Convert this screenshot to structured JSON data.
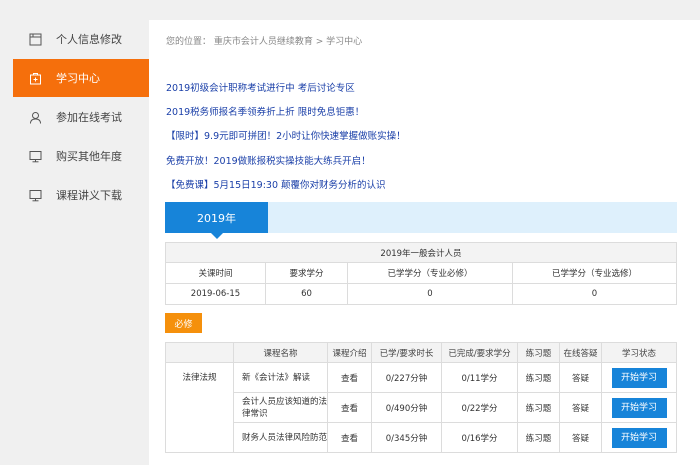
{
  "sidebar": {
    "items": [
      {
        "label": "个人信息修改",
        "icon": "profile-edit-icon"
      },
      {
        "label": "学习中心",
        "icon": "study-center-icon"
      },
      {
        "label": "参加在线考试",
        "icon": "user-icon"
      },
      {
        "label": "购买其他年度",
        "icon": "monitor-icon"
      },
      {
        "label": "课程讲义下载",
        "icon": "monitor-icon"
      }
    ],
    "active_color": "#f56f0c"
  },
  "breadcrumb": {
    "prefix": "您的位置：",
    "path": "重庆市会计人员继续教育 > 学习中心"
  },
  "notices": [
    "2019初级会计职称考试进行中 考后讨论专区",
    "2019税务师报名季领券折上折 限时免息钜惠！",
    "【限时】9.9元即可拼团！2小时让你快速掌握做账实操！",
    "免费开放！2019做账报税实操技能大练兵开启！",
    "【免费课】5月15日19:30 颠覆你对财务分析的认识"
  ],
  "year_tab": "2019年",
  "summary": {
    "title": "2019年一般会计人员",
    "headers": [
      "关课时间",
      "要求学分",
      "已学学分（专业必修）",
      "已学学分（专业选修）"
    ],
    "values": [
      "2019-06-15",
      "60",
      "0",
      "0"
    ]
  },
  "required_badge": "必修",
  "course_table": {
    "headers": [
      "课程名称",
      "课程介绍",
      "已学/要求时长",
      "已完成/要求学分",
      "练习题",
      "在线答疑",
      "学习状态"
    ],
    "category": "法律法规",
    "rows": [
      {
        "name": "新《会计法》解读",
        "intro": "查看",
        "time": "0/227分钟",
        "credit": "0/11学分",
        "exercise": "练习题",
        "qa": "答疑",
        "status": "开始学习"
      },
      {
        "name": "会计人员应该知道的法律常识",
        "intro": "查看",
        "time": "0/490分钟",
        "credit": "0/22学分",
        "exercise": "练习题",
        "qa": "答疑",
        "status": "开始学习"
      },
      {
        "name": "财务人员法律风险防范",
        "intro": "查看",
        "time": "0/345分钟",
        "credit": "0/16学分",
        "exercise": "练习题",
        "qa": "答疑",
        "status": "开始学习"
      }
    ]
  },
  "colors": {
    "accent_orange": "#f56f0c",
    "accent_blue": "#1784d9",
    "link_blue": "#1a3fa8"
  }
}
